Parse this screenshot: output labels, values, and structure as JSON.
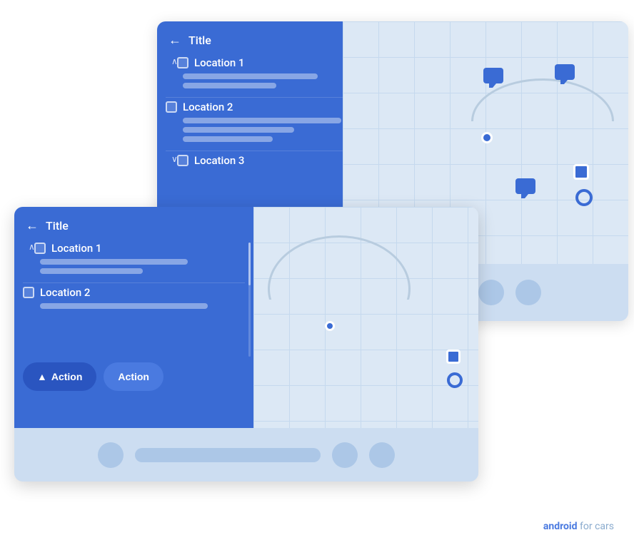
{
  "back_panel": {
    "header": {
      "back_label": "←",
      "title": "Title"
    },
    "list_items": [
      {
        "id": 1,
        "title": "Location 1",
        "bars": [
          80,
          55,
          0
        ],
        "collapsed": false,
        "collapse_icon": "∧"
      },
      {
        "id": 2,
        "title": "Location 2",
        "bars": [
          90,
          65,
          50
        ],
        "collapsed": false,
        "collapse_icon": null
      },
      {
        "id": 3,
        "title": "Location 3",
        "bars": [],
        "collapsed": true,
        "collapse_icon": "∨"
      }
    ]
  },
  "front_panel": {
    "header": {
      "back_label": "←",
      "title": "Title"
    },
    "list_items": [
      {
        "id": 1,
        "title": "Location 1",
        "bars": [
          75,
          50
        ],
        "collapsed": false,
        "collapse_icon": "∧"
      },
      {
        "id": 2,
        "title": "Location 2",
        "bars": [
          85
        ],
        "collapsed": false,
        "collapse_icon": null
      }
    ],
    "action_buttons": [
      {
        "label": "Action",
        "icon": "▲",
        "type": "primary"
      },
      {
        "label": "Action",
        "type": "secondary"
      }
    ]
  },
  "branding": {
    "bold": "android",
    "rest": " for cars"
  }
}
